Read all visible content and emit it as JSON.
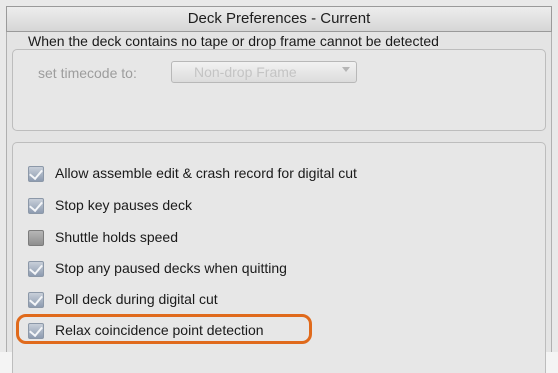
{
  "window": {
    "title": "Deck Preferences - Current"
  },
  "no_tape": {
    "description": "When the deck contains no tape or drop frame cannot be detected",
    "timecode_label": "set timecode to:",
    "timecode_value": "Non-drop Frame"
  },
  "options": [
    {
      "label": "Allow assemble edit & crash record for digital cut",
      "checked": true
    },
    {
      "label": "Stop key pauses deck",
      "checked": true
    },
    {
      "label": "Shuttle holds speed",
      "checked": false
    },
    {
      "label": "Stop any paused decks when quitting",
      "checked": true
    },
    {
      "label": "Poll deck during digital cut",
      "checked": true
    },
    {
      "label": "Relax coincidence point detection",
      "checked": true
    }
  ],
  "colors": {
    "highlight": "#e06a1c",
    "checkbox_checked": "#8d9bb0"
  }
}
